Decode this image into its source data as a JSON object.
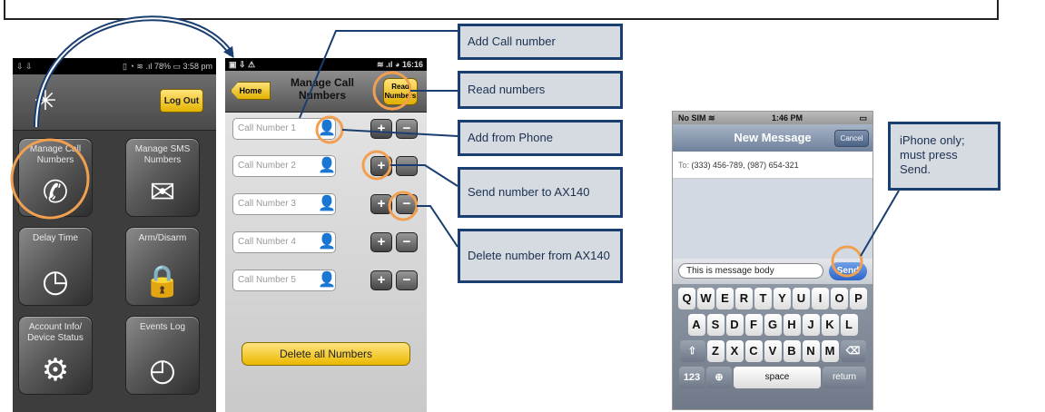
{
  "phone1": {
    "status_left": "⇩ ⇩",
    "status_right": "▯ ◔ ≋ .ıl 78% ▭ 3:58 pm",
    "logout": "Log Out",
    "tiles": [
      {
        "label": "Manage Call Numbers",
        "icon": "phone-icon",
        "glyph": "✆"
      },
      {
        "label": "Manage SMS Numbers",
        "icon": "envelope-icon",
        "glyph": "✉"
      },
      {
        "label": "Delay Time",
        "icon": "timer-icon",
        "glyph": "◷"
      },
      {
        "label": "Arm/Disarm",
        "icon": "padlock-icon",
        "glyph": "🔒"
      },
      {
        "label": "Account Info/ Device Status",
        "icon": "gear-icon",
        "glyph": "⚙"
      },
      {
        "label": "Events Log",
        "icon": "clock-icon",
        "glyph": "◴"
      }
    ]
  },
  "phone2": {
    "status_left": "▣ ⇩ ⚠",
    "status_right": "≋ .ıl ◕ 16:16",
    "home": "Home",
    "title": "Manage Call Numbers",
    "read": "Read Numbers",
    "placeholders": [
      "Call Number 1",
      "Call Number 2",
      "Call Number 3",
      "Call Number 4",
      "Call Number 5"
    ],
    "plus": "+",
    "minus": "−",
    "delete_all": "Delete all Numbers"
  },
  "callouts": {
    "add_call": "Add Call number",
    "read": "Read numbers",
    "add_phone": "Add from Phone",
    "send": "Send number to AX140",
    "delete": "Delete number from AX140",
    "iphone": "iPhone only; must press Send."
  },
  "iphone": {
    "carrier": "No SIM ≋",
    "time": "1:46 PM",
    "battery": "▭",
    "title": "New Message",
    "cancel": "Cancel",
    "to_label": "To:",
    "to_value": "(333) 456-789, (987) 654-321",
    "body": "This is message body",
    "send": "Send",
    "row1": [
      "Q",
      "W",
      "E",
      "R",
      "T",
      "Y",
      "U",
      "I",
      "O",
      "P"
    ],
    "row2": [
      "A",
      "S",
      "D",
      "F",
      "G",
      "H",
      "J",
      "K",
      "L"
    ],
    "row3": [
      "Z",
      "X",
      "C",
      "V",
      "B",
      "N",
      "M"
    ],
    "shift": "⇧",
    "backspace": "⌫",
    "numbers": "123",
    "globe": "⊕",
    "space": "space",
    "return": "return"
  },
  "colors": {
    "callout_border": "#1a3e70",
    "highlight": "#f0a050",
    "accent_yellow": "#e4b400"
  }
}
